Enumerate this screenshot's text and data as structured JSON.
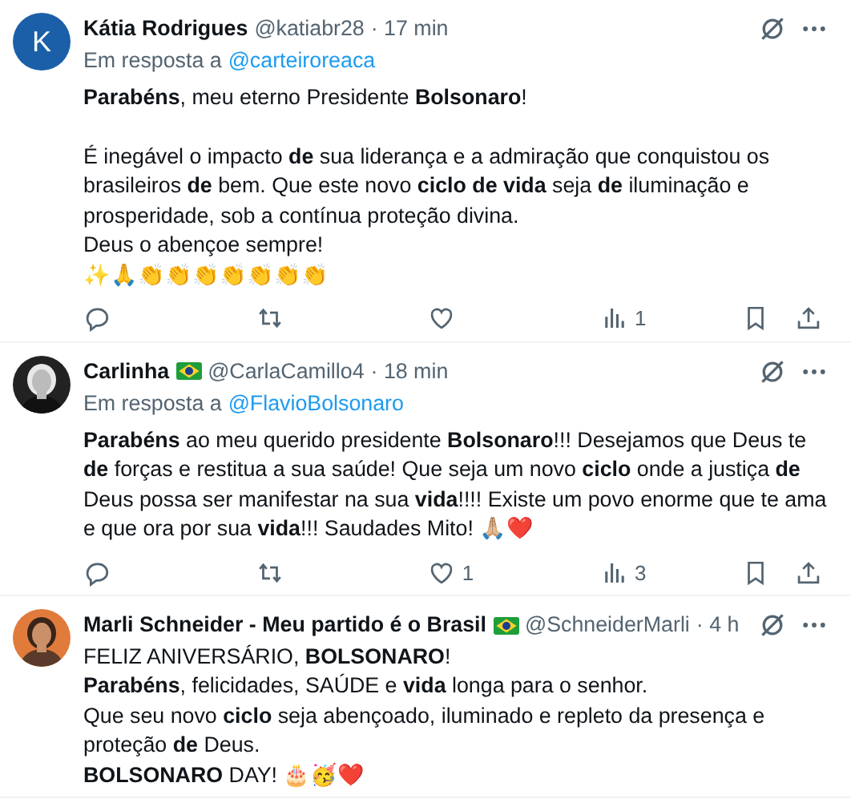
{
  "tweets": [
    {
      "avatar": {
        "kind": "letter",
        "letter": "K"
      },
      "name": "Kátia Rodrigues",
      "flag": false,
      "handle": "@katiabr28",
      "time": "· 17 min",
      "reply_to": {
        "label": "Em resposta a",
        "handle": "@carteiroreaca"
      },
      "paragraphs": [
        [
          "**Parabéns**, meu eterno Presidente **Bolsonaro**!"
        ],
        [
          "É inegável o impacto **de** sua liderança e a admiração que conquistou os brasileiros **de** bem. Que este novo **ciclo de vida** seja **de** iluminação e prosperidade, sob a contínua proteção divina.",
          "Deus o abençoe sempre!",
          "✨🙏👏👏👏👏👏👏👏"
        ]
      ],
      "actions": {
        "views": "1"
      }
    },
    {
      "avatar": {
        "kind": "picture"
      },
      "name": "Carlinha",
      "flag": true,
      "handle": "@CarlaCamillo4",
      "time": "· 18 min",
      "reply_to": {
        "label": "Em resposta a",
        "handle": "@FlavioBolsonaro"
      },
      "paragraphs": [
        [
          "**Parabéns** ao meu querido presidente **Bolsonaro**!!! Desejamos que Deus te **de** forças e restitua a sua saúde! Que seja um novo **ciclo** onde a justiça **de** Deus possa ser manifestar na sua **vida**!!!! Existe um povo enorme que te ama e que ora por sua **vida**!!! Saudades Mito! 🙏🏼❤️"
        ]
      ],
      "actions": {
        "likes": "1",
        "views": "3"
      }
    },
    {
      "avatar": {
        "kind": "picture"
      },
      "name": "Marli Schneider - Meu partido é o Brasil",
      "flag": true,
      "handle": "@SchneiderMarli",
      "time": "· 4 h",
      "paragraphs": [
        [
          "FELIZ ANIVERSÁRIO, **BOLSONARO**!",
          "**Parabéns**, felicidades, SAÚDE e **vida** longa para o senhor.",
          "Que seu novo **ciclo** seja abençoado, iluminado e repleto da presença e proteção **de** Deus.",
          "**BOLSONARO** DAY! 🎂🥳❤️"
        ]
      ]
    }
  ]
}
